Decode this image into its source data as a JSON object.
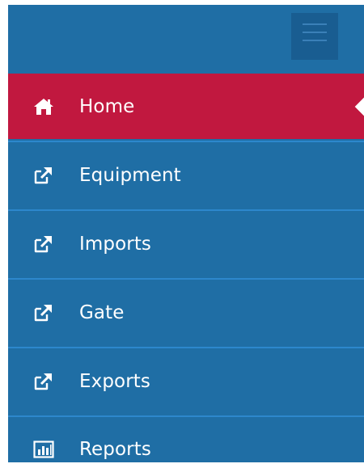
{
  "menu": {
    "items": [
      {
        "label": "Home",
        "icon": "home-icon",
        "active": true
      },
      {
        "label": "Equipment",
        "icon": "external-link-icon",
        "active": false
      },
      {
        "label": "Imports",
        "icon": "external-link-icon",
        "active": false
      },
      {
        "label": "Gate",
        "icon": "external-link-icon",
        "active": false
      },
      {
        "label": "Exports",
        "icon": "external-link-icon",
        "active": false
      },
      {
        "label": "Reports",
        "icon": "bar-chart-icon",
        "active": false
      }
    ]
  },
  "colors": {
    "sidebar_bg": "#1f6ea5",
    "active_bg": "#c1183f",
    "hamburger_bg": "#195d91",
    "text": "#ffffff"
  }
}
